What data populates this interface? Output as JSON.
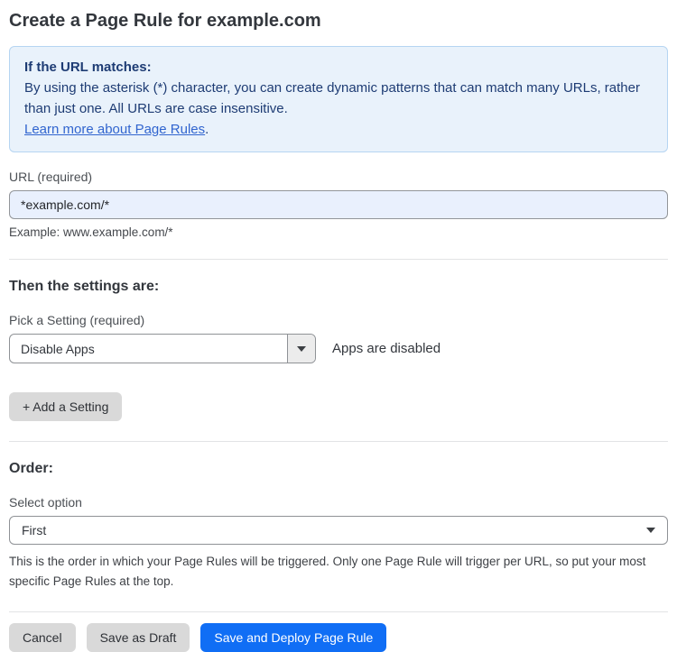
{
  "page": {
    "title": "Create a Page Rule for example.com"
  },
  "info_box": {
    "heading": "If the URL matches:",
    "body": "By using the asterisk (*) character, you can create dynamic patterns that can match many URLs, rather than just one. All URLs are case insensitive.",
    "link": "Learn more about Page Rules",
    "link_suffix": "."
  },
  "url_field": {
    "label": "URL (required)",
    "value": "*example.com/*",
    "example": "Example: www.example.com/*"
  },
  "settings_section": {
    "heading": "Then the settings are:",
    "picker_label": "Pick a Setting (required)",
    "picker_value": "Disable Apps",
    "status_text": "Apps are disabled",
    "add_button_label": "+ Add a Setting"
  },
  "order_section": {
    "heading": "Order:",
    "select_label": "Select option",
    "select_value": "First",
    "help_text": "This is the order in which your Page Rules will be triggered. Only one Page Rule will trigger per URL, so put your most specific Page Rules at the top."
  },
  "actions": {
    "cancel_label": "Cancel",
    "save_draft_label": "Save as Draft",
    "save_deploy_label": "Save and Deploy Page Rule"
  },
  "colors": {
    "accent_blue": "#106ef5",
    "info_background": "#e9f2fb",
    "info_border": "#b6d5f2",
    "info_text": "#1e3c74",
    "link_blue": "#3165cf",
    "input_background": "#e9f0fd",
    "button_gray": "#d9d9d9"
  }
}
